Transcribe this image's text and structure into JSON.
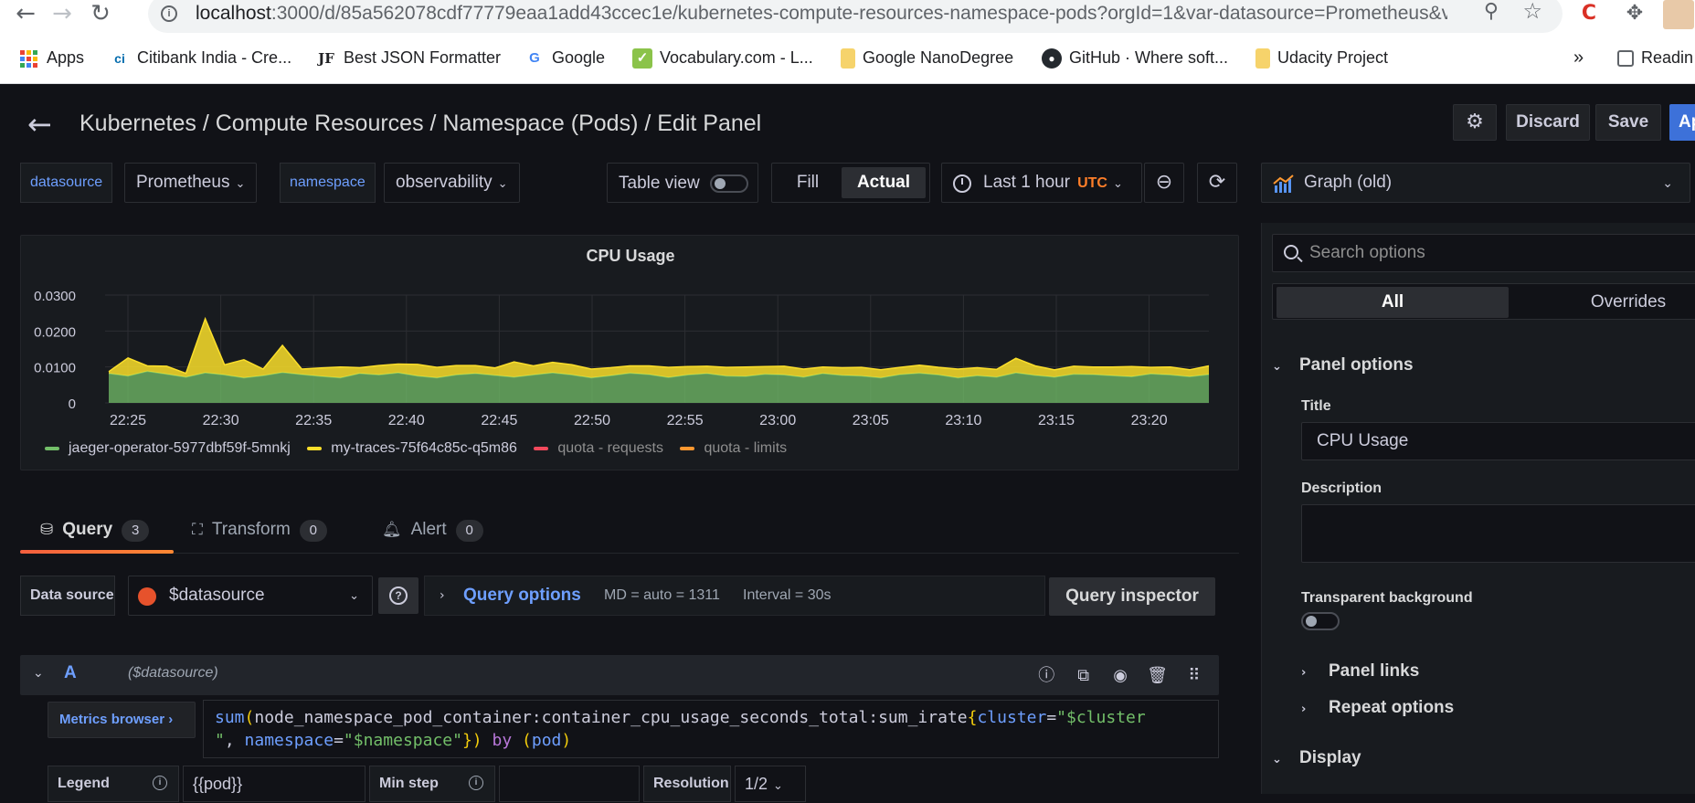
{
  "browser": {
    "url_host": "localhost",
    "url_rest": ":3000/d/85a562078cdf77779eaa1add43ccec1e/kubernetes-compute-resources-namespace-pods?orgId=1&var-datasource=Prometheus&v...",
    "bookmarks": [
      {
        "label": "Apps"
      },
      {
        "label": "Citibank India - Cre..."
      },
      {
        "label": "Best JSON Formatter"
      },
      {
        "label": "Google"
      },
      {
        "label": "Vocabulary.com - L..."
      },
      {
        "label": "Google NanoDegree"
      },
      {
        "label": "GitHub · Where soft..."
      },
      {
        "label": "Udacity Project"
      }
    ],
    "overflow": "»",
    "reading": "Readin"
  },
  "header": {
    "title": "Kubernetes / Compute Resources / Namespace (Pods) / Edit Panel",
    "discard": "Discard",
    "save": "Save",
    "apply": "Ap"
  },
  "vars": {
    "datasource_label": "datasource",
    "datasource_value": "Prometheus",
    "namespace_label": "namespace",
    "namespace_value": "observability"
  },
  "toolbar": {
    "table_view": "Table view",
    "fill": "Fill",
    "actual": "Actual",
    "time_range": "Last 1 hour",
    "timezone": "UTC"
  },
  "viz": {
    "name": "Graph (old)"
  },
  "chart_data": {
    "type": "area",
    "title": "CPU Usage",
    "ylim": [
      0,
      0.03
    ],
    "y_ticks": [
      "0",
      "0.0100",
      "0.0200",
      "0.0300"
    ],
    "x_ticks": [
      "22:25",
      "22:30",
      "22:35",
      "22:40",
      "22:45",
      "22:50",
      "22:55",
      "23:00",
      "23:05",
      "23:10",
      "23:15",
      "23:20"
    ],
    "grid": true,
    "stacked": true,
    "series": [
      {
        "name": "jaeger-operator-5977dbf59f-5mnkj",
        "color": "#73bf69",
        "values": [
          0.0082,
          0.0075,
          0.0088,
          0.008,
          0.0072,
          0.0084,
          0.0078,
          0.007,
          0.0076,
          0.0085,
          0.0079,
          0.0074,
          0.007,
          0.0082,
          0.0078,
          0.0084,
          0.0075,
          0.007,
          0.0078,
          0.0082,
          0.0077,
          0.0072,
          0.0078,
          0.0084,
          0.0078,
          0.007,
          0.0076,
          0.0083,
          0.0079,
          0.0071,
          0.0078,
          0.0082,
          0.0075,
          0.0074,
          0.008,
          0.0078,
          0.0072,
          0.0082,
          0.0077,
          0.0075,
          0.007,
          0.0079,
          0.0083,
          0.0078,
          0.007,
          0.0076,
          0.0072,
          0.0084,
          0.0077,
          0.0072,
          0.008,
          0.0079,
          0.0076,
          0.0073,
          0.0081,
          0.0078,
          0.0073,
          0.0079
        ]
      },
      {
        "name": "my-traces-75f64c85c-q5m86",
        "color": "#fade2a",
        "values": [
          0.0005,
          0.005,
          0.0015,
          0.0022,
          0.001,
          0.015,
          0.0028,
          0.005,
          0.0018,
          0.0075,
          0.0015,
          0.0023,
          0.003,
          0.0016,
          0.0026,
          0.0024,
          0.0032,
          0.0029,
          0.0026,
          0.0022,
          0.002,
          0.0042,
          0.0025,
          0.0029,
          0.0028,
          0.0024,
          0.0022,
          0.002,
          0.0024,
          0.0028,
          0.0023,
          0.002,
          0.0024,
          0.0026,
          0.0021,
          0.0024,
          0.0022,
          0.0018,
          0.0021,
          0.0024,
          0.0022,
          0.002,
          0.0022,
          0.0021,
          0.0024,
          0.0022,
          0.0021,
          0.004,
          0.0026,
          0.002,
          0.0022,
          0.0021,
          0.0024,
          0.0028,
          0.0018,
          0.0022,
          0.0019,
          0.0024
        ]
      },
      {
        "name": "quota - requests",
        "color": "#f2495c",
        "values": []
      },
      {
        "name": "quota - limits",
        "color": "#ff9830",
        "values": []
      }
    ]
  },
  "tabs": [
    {
      "label": "Query",
      "count": "3"
    },
    {
      "label": "Transform",
      "count": "0"
    },
    {
      "label": "Alert",
      "count": "0"
    }
  ],
  "query": {
    "ds_label": "Data source",
    "ds_value": "$datasource",
    "options_label": "Query options",
    "md": "MD = auto = 1311",
    "interval": "Interval = 30s",
    "inspector": "Query inspector",
    "ref": "A",
    "row_ds": "($datasource)",
    "metrics_browser": "Metrics browser",
    "expr_fn": "sum",
    "expr_metric": "node_namespace_pod_container:container_cpu_usage_seconds_total:sum_irate",
    "expr_l1": "cluster",
    "expr_v1": "\"$cluster",
    "expr_v1b": "\"",
    "expr_l2": "namespace",
    "expr_v2": "\"$namespace\"",
    "expr_by": "by",
    "expr_grp": "pod",
    "legend_label": "Legend",
    "legend_value": "{{pod}}",
    "minstep_label": "Min step",
    "resolution_label": "Resolution",
    "resolution_value": "1/2"
  },
  "options": {
    "search_placeholder": "Search options",
    "all": "All",
    "overrides": "Overrides",
    "panel_options": "Panel options",
    "title_label": "Title",
    "title_value": "CPU Usage",
    "description_label": "Description",
    "transparent_label": "Transparent background",
    "panel_links": "Panel links",
    "repeat_options": "Repeat options",
    "display": "Display"
  }
}
